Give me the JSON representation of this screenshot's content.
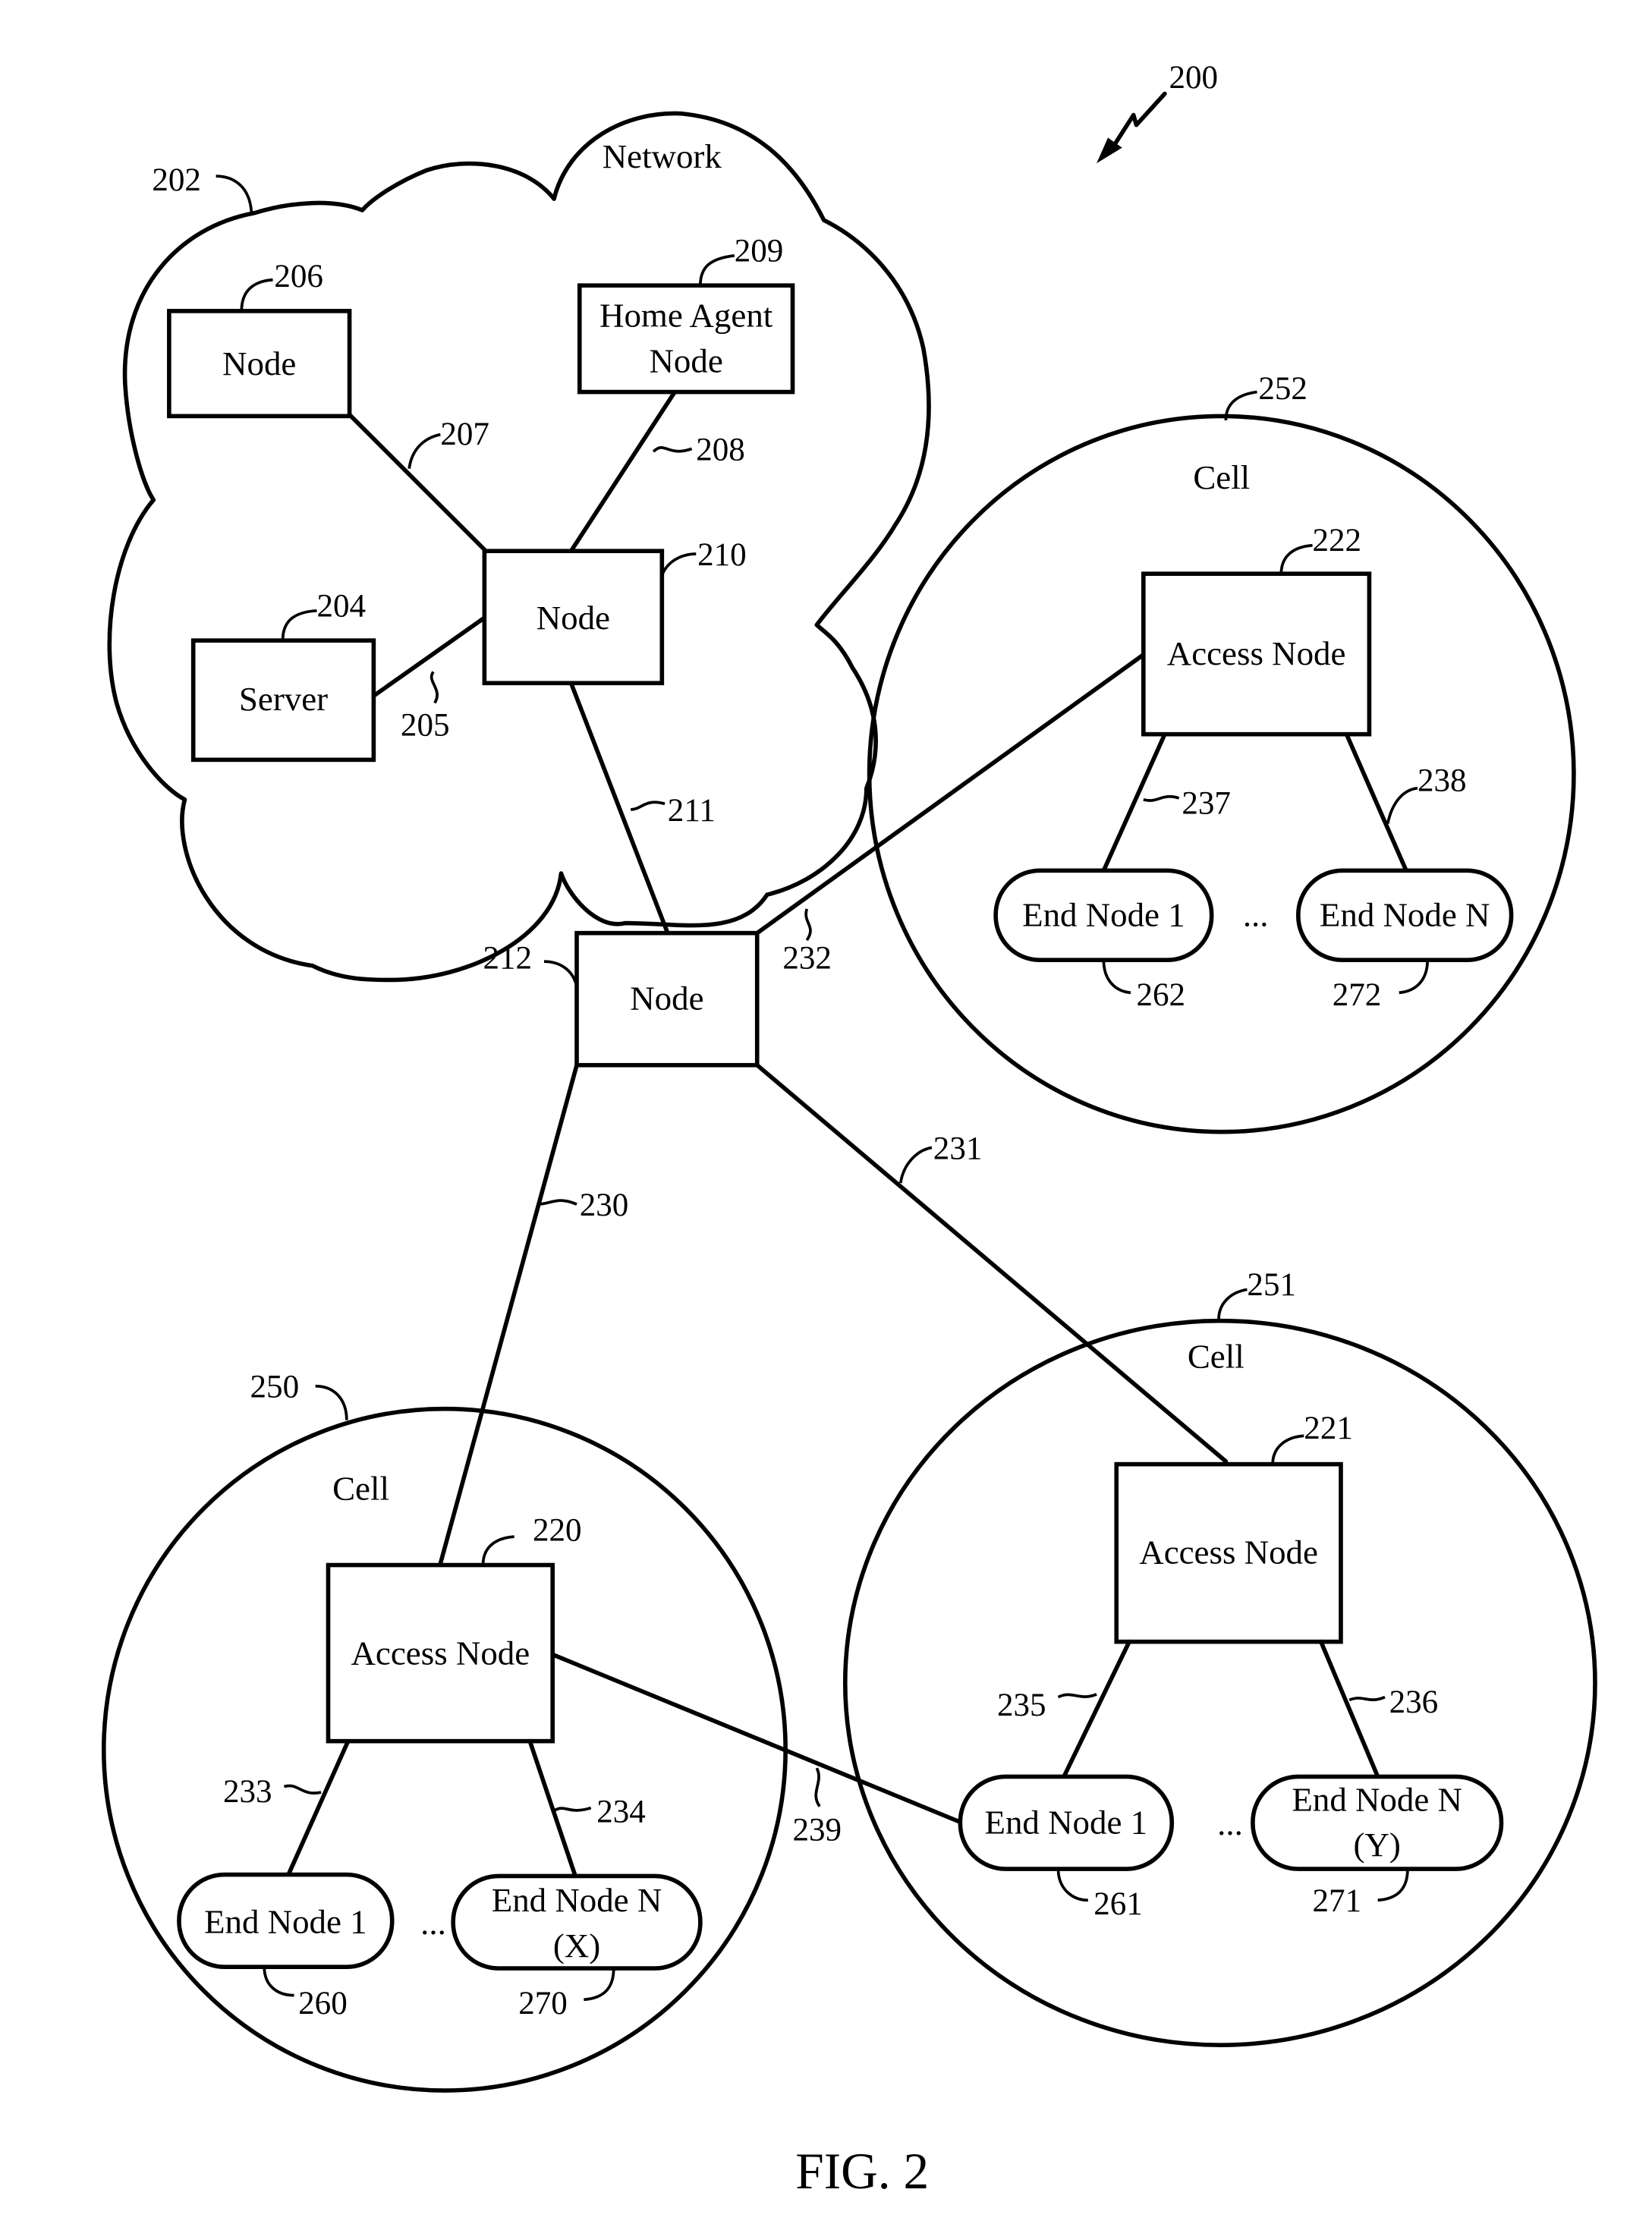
{
  "figure": {
    "ref": "200",
    "caption": "FIG. 2"
  },
  "network": {
    "ref": "202",
    "label": "Network",
    "nodes": {
      "node_206": {
        "ref": "206",
        "label": "Node"
      },
      "home_agent_209": {
        "ref": "209",
        "label_line1": "Home Agent",
        "label_line2": "Node"
      },
      "server_204": {
        "ref": "204",
        "label": "Server"
      },
      "node_210": {
        "ref": "210",
        "label": "Node"
      }
    },
    "links": {
      "l207": "207",
      "l208": "208",
      "l205": "205",
      "l211": "211"
    }
  },
  "node_212": {
    "ref": "212",
    "label": "Node"
  },
  "backhaul_links": {
    "l230": "230",
    "l231": "231",
    "l232": "232",
    "l239": "239"
  },
  "cells": {
    "cell_250": {
      "ref": "250",
      "label": "Cell",
      "access_node": {
        "ref": "220",
        "label": "Access Node"
      },
      "links": {
        "a": "233",
        "b": "234"
      },
      "end_node_1": {
        "ref": "260",
        "label": "End Node 1"
      },
      "ellipsis": "...",
      "end_node_n": {
        "ref": "270",
        "label_line1": "End Node N",
        "label_line2": "(X)"
      }
    },
    "cell_251": {
      "ref": "251",
      "label": "Cell",
      "access_node": {
        "ref": "221",
        "label": "Access Node"
      },
      "links": {
        "a": "235",
        "b": "236"
      },
      "end_node_1": {
        "ref": "261",
        "label": "End Node 1"
      },
      "ellipsis": "...",
      "end_node_n": {
        "ref": "271",
        "label_line1": "End Node N",
        "label_line2": "(Y)"
      }
    },
    "cell_252": {
      "ref": "252",
      "label": "Cell",
      "access_node": {
        "ref": "222",
        "label": "Access Node"
      },
      "links": {
        "a": "237",
        "b": "238"
      },
      "end_node_1": {
        "ref": "262",
        "label": "End Node 1"
      },
      "ellipsis": "...",
      "end_node_n": {
        "ref": "272",
        "label": "End Node N"
      }
    }
  }
}
